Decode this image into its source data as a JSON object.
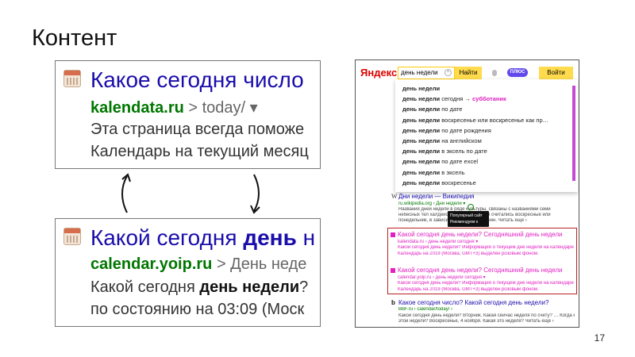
{
  "slide": {
    "title": "Контент",
    "page_number": "17"
  },
  "snippet_before": {
    "title": "Какое сегодня число",
    "url_domain": "kalendata.ru",
    "url_path": " > today/",
    "url_caret": " ▾",
    "line1": "Эта страница всегда поможе",
    "line2": "Календарь на текущий месяц"
  },
  "snippet_after": {
    "title_prefix": "Какой сегодня ",
    "title_bold": "день",
    "title_suffix": " н",
    "url_domain": "calendar.yoip.ru",
    "url_path": " > День неде",
    "line1_prefix": "Какой сегодня ",
    "line1_bold": "день недели",
    "line1_suffix": "?",
    "line2": "по состоянию на 03:09 (Моск"
  },
  "yandex": {
    "logo": "Яндекс",
    "query": "день недели",
    "clear_icon": "×",
    "find_button": "Найти",
    "plus_badge": "ПЛЮС",
    "login_button": "Войти",
    "suggestions": [
      {
        "bold": "день недели",
        "rest": ""
      },
      {
        "bold": "день недели",
        "rest": " сегодня → ",
        "highlight": "субботаник"
      },
      {
        "bold": "день недели",
        "rest": " по дате"
      },
      {
        "bold": "день недели",
        "rest": " воскресенье или воскресенье как пр…"
      },
      {
        "bold": "день недели",
        "rest": " по дате рождения"
      },
      {
        "bold": "день недели",
        "rest": " на английском"
      },
      {
        "bold": "день недели",
        "rest": " в эксель по дате"
      },
      {
        "bold": "день недели",
        "rest": " по дате excel"
      },
      {
        "bold": "день недели",
        "rest": " в эксель"
      },
      {
        "bold": "день недели",
        "rest": " воскресенье"
      }
    ],
    "wiki_result": {
      "title": "Дни недели — Википедия",
      "url": "ru.wikipedia.org › Дни недели ▾",
      "snippet1": "Названия дней недели в ряде культуры, связаны с названиями семи",
      "snippet2": "небесных тел халдейской… Воскресенье считались воскресные или",
      "snippet3": "понедельник, в зависимос… разных причин. Читать ещё ›"
    },
    "tooltip": "Популярный сайт\nРекомендуем к посещению",
    "boxed_result_a": {
      "title": "Какой сегодня день недели? Сегодняшний день недели",
      "url": "kalendata.ru › день недели сегодня ▾",
      "s1": "Какой сегодня день недели? Информация о текущем дне недели на календаре",
      "s2": "Календарь на 2019 (Москва, GMT+3) выделен розовым фоном."
    },
    "boxed_result_b": {
      "title": "Какой сегодня день недели? Сегодняшний день недели",
      "url": "calendar.yoip.ru › день недели сегодня ▾",
      "s1": "Какой сегодня день недели? Информация о текущем дне недели на календаре",
      "s2": "Календарь на 2019 (Москва, GMT+3) выделен розовым фоном."
    },
    "bbf_result": {
      "icon": "b",
      "title": "Какое сегодня число? Какой сегодня день недели?",
      "url": "BBF.ru › calendar/today/ ›",
      "s1": "Какой сегодня день недели? Вторник. Какая сейчас неделя по счету? … Когда конец",
      "s2": "этой недели? Воскресенье, 4 ноября. Какая это неделя? Читать ещё ›"
    }
  }
}
